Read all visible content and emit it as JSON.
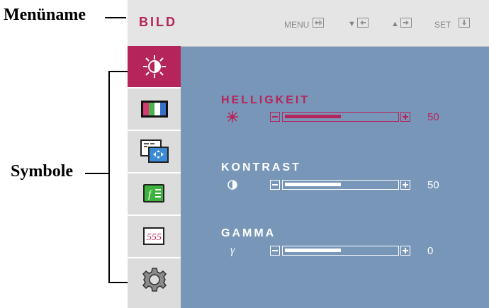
{
  "annotations": {
    "menu_name": "Menüname",
    "symbols": "Symbole"
  },
  "osd": {
    "menu_title": "BILD",
    "keys": [
      {
        "label": "MENU",
        "icon": "menu-enter-icon"
      },
      {
        "label": "▼",
        "icon": "arrow-left-icon"
      },
      {
        "label": "▲",
        "icon": "arrow-right-icon"
      },
      {
        "label": "SET",
        "icon": "arrow-down-icon"
      }
    ],
    "sidebar_icons": [
      {
        "name": "brightness-contrast-icon",
        "active": true
      },
      {
        "name": "color-bars-icon",
        "active": false
      },
      {
        "name": "screen-position-icon",
        "active": false
      },
      {
        "name": "function-icon",
        "active": false
      },
      {
        "name": "signal-wave-icon",
        "active": false
      },
      {
        "name": "settings-gear-icon",
        "active": false
      }
    ],
    "settings": [
      {
        "label": "HELLIGKEIT",
        "symbol": "sun-icon",
        "value": "50",
        "level": 0.5,
        "active": true
      },
      {
        "label": "KONTRAST",
        "symbol": "half-circle-icon",
        "value": "50",
        "level": 0.5,
        "active": false
      },
      {
        "label": "GAMMA",
        "symbol": "γ",
        "value": "0",
        "level": 0.5,
        "active": false
      }
    ],
    "colors": {
      "accent": "#b5255b",
      "panel": "#7897b8",
      "sidebar": "#dcdcdc",
      "header": "#e5e5e5"
    }
  }
}
